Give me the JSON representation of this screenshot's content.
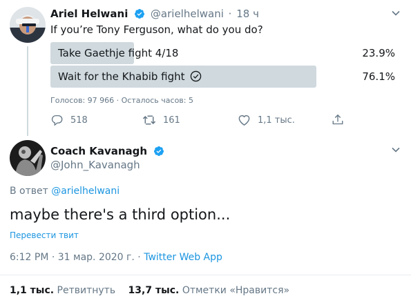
{
  "tweet1": {
    "name": "Ariel Helwani",
    "handle": "@arielhelwani",
    "separator": "·",
    "time": "18 ч",
    "text": "If you’re Tony Ferguson, what do you do?",
    "poll": {
      "options": [
        {
          "label": "Take Gaethje fight 4/18",
          "percent": "23.9%",
          "fraction": 0.239
        },
        {
          "label": "Wait for the Khabib fight",
          "percent": "76.1%",
          "fraction": 0.761,
          "winner": true
        }
      ],
      "meta": "Голосов: 97 966 · Осталось часов: 5"
    },
    "actions": {
      "replies": "518",
      "retweets": "161",
      "likes": "1,1 тыс."
    }
  },
  "tweet2": {
    "name": "Coach Kavanagh",
    "handle": "@John_Kavanagh",
    "reply_prefix": "В ответ",
    "reply_to": "@arielhelwani",
    "text": "maybe there's a third option...",
    "translate": "Перевести твит",
    "timestamp": "6:12 PM · 31 мар. 2020 г. ·",
    "source": "Twitter Web App",
    "stats": {
      "retweets_count": "1,1 тыс.",
      "retweets_label": "Ретвитнуть",
      "likes_count": "13,7 тыс.",
      "likes_label": "Отметки «Нравится»"
    }
  },
  "colors": {
    "accent": "#1da1f2",
    "link": "#1b95e0",
    "muted": "#657786",
    "poll_bar": "#cfd9de"
  },
  "icons": [
    "verified-badge-icon",
    "chevron-down-icon",
    "reply-icon",
    "retweet-icon",
    "like-icon",
    "share-icon",
    "check-circle-icon"
  ]
}
